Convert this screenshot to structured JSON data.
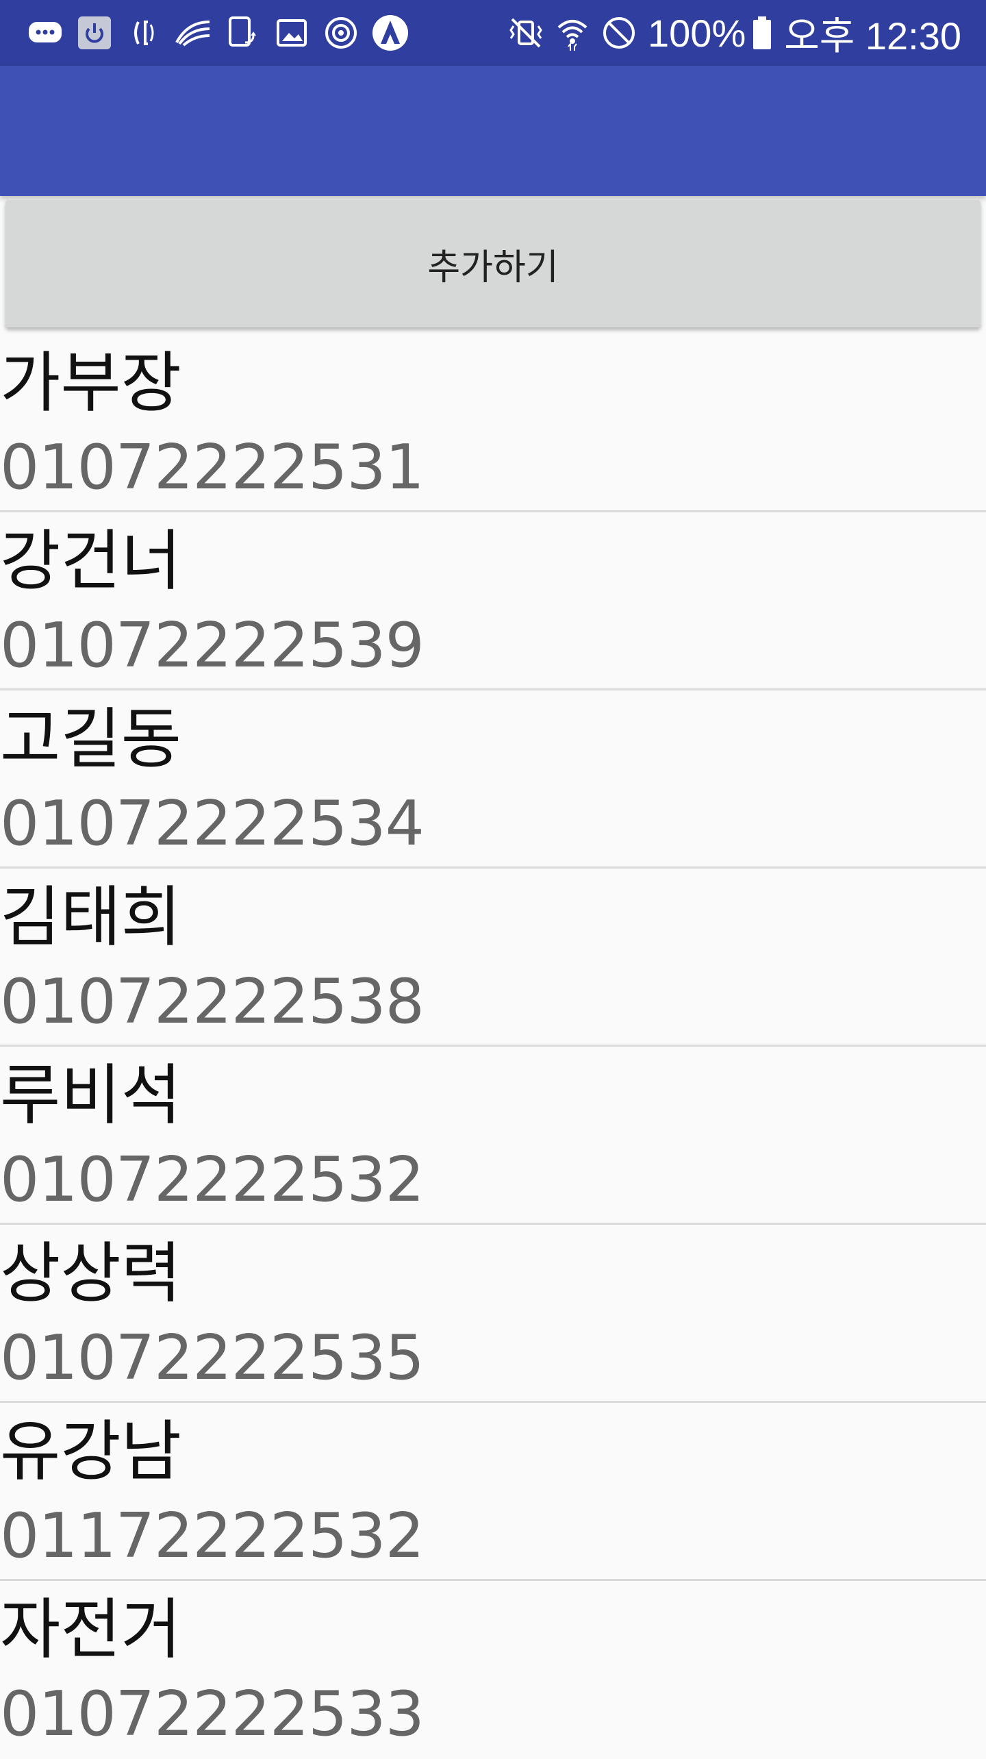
{
  "status_bar": {
    "left_icons": [
      "chat-bubble-icon",
      "power-icon",
      "nfc-icon",
      "wing-icon",
      "tablet-sync-icon",
      "image-icon",
      "target-icon",
      "astro-icon"
    ],
    "right_icons": [
      "vibrate-icon",
      "wifi-icon",
      "blocked-icon"
    ],
    "battery_percent": "100%",
    "battery_level": 1.0,
    "time": "오후 12:30"
  },
  "colors": {
    "status_bar": "#303f9f",
    "app_bar": "#3f51b5",
    "button_bg": "#d6d7d7",
    "background": "#fafafa",
    "phone_text": "#666666"
  },
  "toolbar": {
    "add_label": "추가하기"
  },
  "contacts": [
    {
      "name": "가부장",
      "phone": "01072222531"
    },
    {
      "name": "강건너",
      "phone": "01072222539"
    },
    {
      "name": "고길동",
      "phone": "01072222534"
    },
    {
      "name": "김태희",
      "phone": "01072222538"
    },
    {
      "name": "루비석",
      "phone": "01072222532"
    },
    {
      "name": "상상력",
      "phone": "01072222535"
    },
    {
      "name": "유강남",
      "phone": "01172222532"
    },
    {
      "name": "자전거",
      "phone": "01072222533"
    }
  ]
}
